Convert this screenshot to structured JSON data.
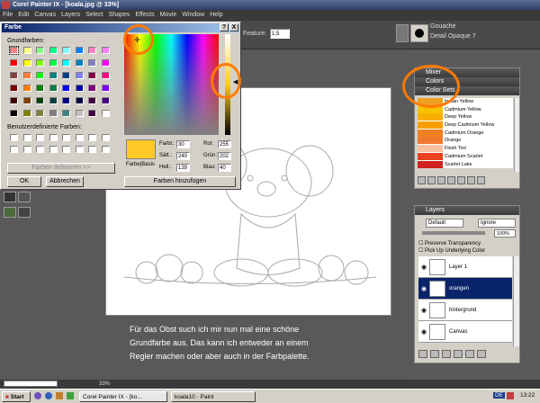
{
  "app": {
    "title": "Corel Painter IX - [koala.jpg @ 33%]"
  },
  "menu": [
    "File",
    "Edit",
    "Canvas",
    "Layers",
    "Select",
    "Shapes",
    "Effects",
    "Movie",
    "Window",
    "Help"
  ],
  "propbar": {
    "feature_label": "Feature:",
    "feature_value": "1,5",
    "brush_category": "Gouache",
    "brush_variant": "Detail Opaque 7"
  },
  "color_dialog": {
    "title": "Farbe",
    "help_button": "?",
    "close_button": "X",
    "basic_colors_label": "Grundfarben:",
    "custom_colors_label": "Benutzerdefinierte Farben:",
    "define_button": "Farben definieren >>",
    "ok_button": "OK",
    "cancel_button": "Abbrechen",
    "preview_label": "Farbe|Basis",
    "add_button": "Farben hinzufügen",
    "hue_label": "Farbt.:",
    "hue_value": "30",
    "sat_label": "Sätt.:",
    "sat_value": "240",
    "lum_label": "Hell.:",
    "lum_value": "139",
    "red_label": "Rot:",
    "red_value": "255",
    "green_label": "Grün:",
    "green_value": "202",
    "blue_label": "Blau:",
    "blue_value": "40",
    "basic_colors": [
      "#ff8080",
      "#ffff80",
      "#80ff80",
      "#00ff80",
      "#80ffff",
      "#0080ff",
      "#ff80c0",
      "#ff80ff",
      "#ff0000",
      "#ffff00",
      "#80ff00",
      "#00ff40",
      "#00ffff",
      "#0080c0",
      "#8080c0",
      "#ff00ff",
      "#804040",
      "#ff8040",
      "#00ff00",
      "#008080",
      "#004080",
      "#8080ff",
      "#800040",
      "#ff0080",
      "#800000",
      "#ff8000",
      "#008000",
      "#008040",
      "#0000ff",
      "#0000a0",
      "#800080",
      "#8000ff",
      "#400000",
      "#804000",
      "#004000",
      "#004040",
      "#000080",
      "#000040",
      "#400040",
      "#400080",
      "#000000",
      "#808000",
      "#808040",
      "#808080",
      "#408080",
      "#c0c0c0",
      "#400040",
      "#ffffff"
    ],
    "preview_color": "#ffca28"
  },
  "panels": {
    "mixer": "Mixer",
    "colors": "Colors",
    "color_sets": "Color Sets",
    "color_list": [
      {
        "name": "Indian Yellow",
        "color": "#f0a020"
      },
      {
        "name": "Cadmium Yellow",
        "color": "#f7c200"
      },
      {
        "name": "Deep Yellow",
        "color": "#f8b000"
      },
      {
        "name": "Deep Cadmium Yellow",
        "color": "#f5a000"
      },
      {
        "name": "Cadmium Orange",
        "color": "#f08020"
      },
      {
        "name": "Orange",
        "color": "#f07a30"
      },
      {
        "name": "Flesh Tint",
        "color": "#f8c0a0"
      },
      {
        "name": "Cadmium Scarlet",
        "color": "#e84020"
      },
      {
        "name": "Scarlet Lake",
        "color": "#d02020"
      }
    ],
    "layers_title": "Layers",
    "composite_method": "Default",
    "depth_method": "Ignore",
    "opacity": "100%",
    "preserve_transparency": "Preserve Transparency",
    "pick_up_color": "Pick Up Underlying Color",
    "layers": [
      {
        "name": "Layer 1",
        "selected": false
      },
      {
        "name": "orangen",
        "selected": true
      },
      {
        "name": "hintergrund",
        "selected": false
      },
      {
        "name": "Canvas",
        "selected": false
      }
    ]
  },
  "caption": "Für das Obst such ich mir nun mal eine schöne\nGrundfarbe aus. Das kann ich entweder an einem\nRegler machen oder aber auch in der Farbpalette.",
  "status": {
    "zoom": "33%"
  },
  "taskbar": {
    "start": "Start",
    "tasks": [
      "Corel Painter IX - [ko...",
      "koala10 - Paint"
    ],
    "lang": "DE",
    "time": "13:22"
  }
}
